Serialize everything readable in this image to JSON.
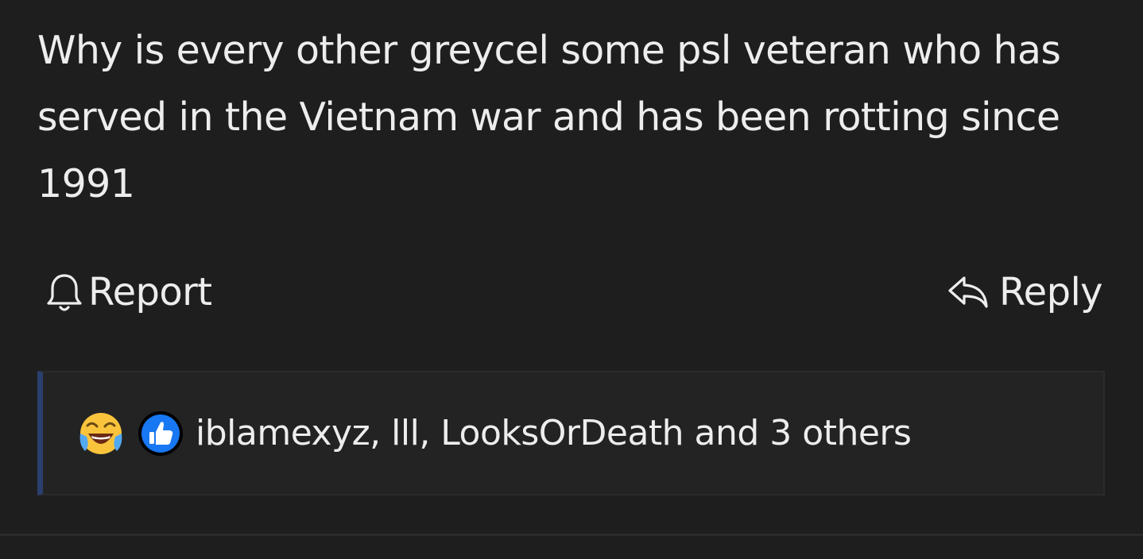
{
  "post": {
    "body": "Why is every other greycel some psl veteran who has served in the Vietnam war and has been rotting since 1991"
  },
  "actions": {
    "report_label": "Report",
    "reply_label": "Reply",
    "report_icon": "bell-icon",
    "reply_icon": "reply-arrow-icon"
  },
  "reactions": {
    "emojis": [
      "laughing-crying-emoji",
      "thumbs-up-emoji"
    ],
    "users_text": "iblamexyz, lll, LooksOrDeath and 3 others"
  },
  "colors": {
    "background": "#1e1e1f",
    "reaction_panel": "#232324",
    "reaction_accent": "#2a3f6e",
    "like_blue": "#1877f2",
    "text": "#ededed"
  }
}
